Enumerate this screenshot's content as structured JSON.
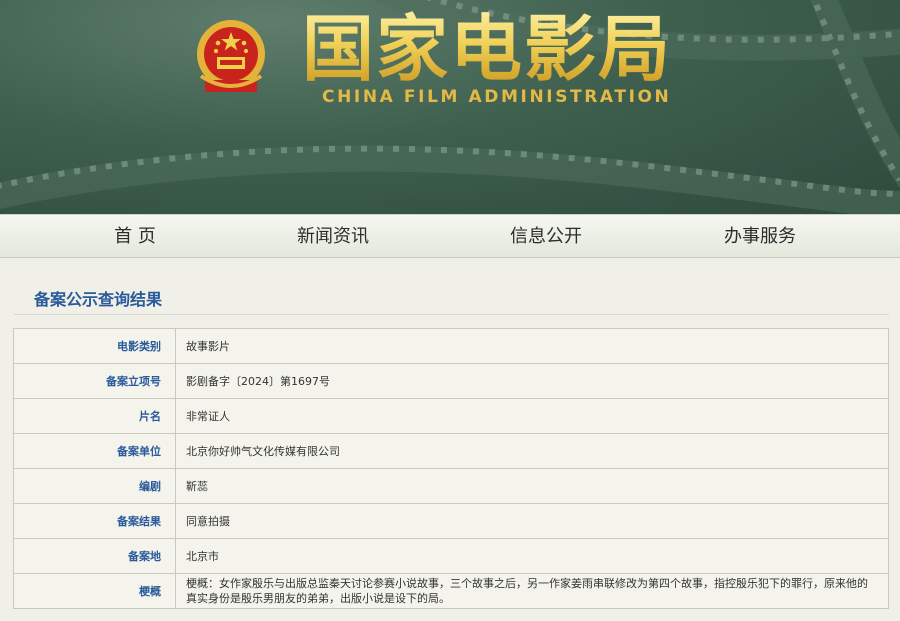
{
  "header": {
    "title_cn": "国家电影局",
    "title_en": "CHINA FILM ADMINISTRATION",
    "emblem_icon": "national-emblem-icon",
    "colors": {
      "banner": "#3e5f4e",
      "gold": "#e2b947"
    }
  },
  "nav": {
    "items": [
      {
        "label": "首 页"
      },
      {
        "label": "新闻资讯"
      },
      {
        "label": "信息公开"
      },
      {
        "label": "办事服务"
      }
    ]
  },
  "main": {
    "section_title": "备案公示查询结果",
    "rows": [
      {
        "label": "电影类别",
        "value": "故事影片"
      },
      {
        "label": "备案立项号",
        "value": "影剧备字〔2024〕第1697号"
      },
      {
        "label": "片名",
        "value": "非常证人"
      },
      {
        "label": "备案单位",
        "value": "北京你好帅气文化传媒有限公司"
      },
      {
        "label": "编剧",
        "value": "靳蕊"
      },
      {
        "label": "备案结果",
        "value": "同意拍摄"
      },
      {
        "label": "备案地",
        "value": "北京市"
      },
      {
        "label": "梗概",
        "value": "梗概：女作家殷乐与出版总监秦天讨论参赛小说故事，三个故事之后，另一作家姜雨串联修改为第四个故事，指控殷乐犯下的罪行，原来他的真实身份是殷乐男朋友的弟弟，出版小说是设下的局。"
      }
    ],
    "colors": {
      "label": "#2a5a9a",
      "value": "#333333"
    }
  }
}
